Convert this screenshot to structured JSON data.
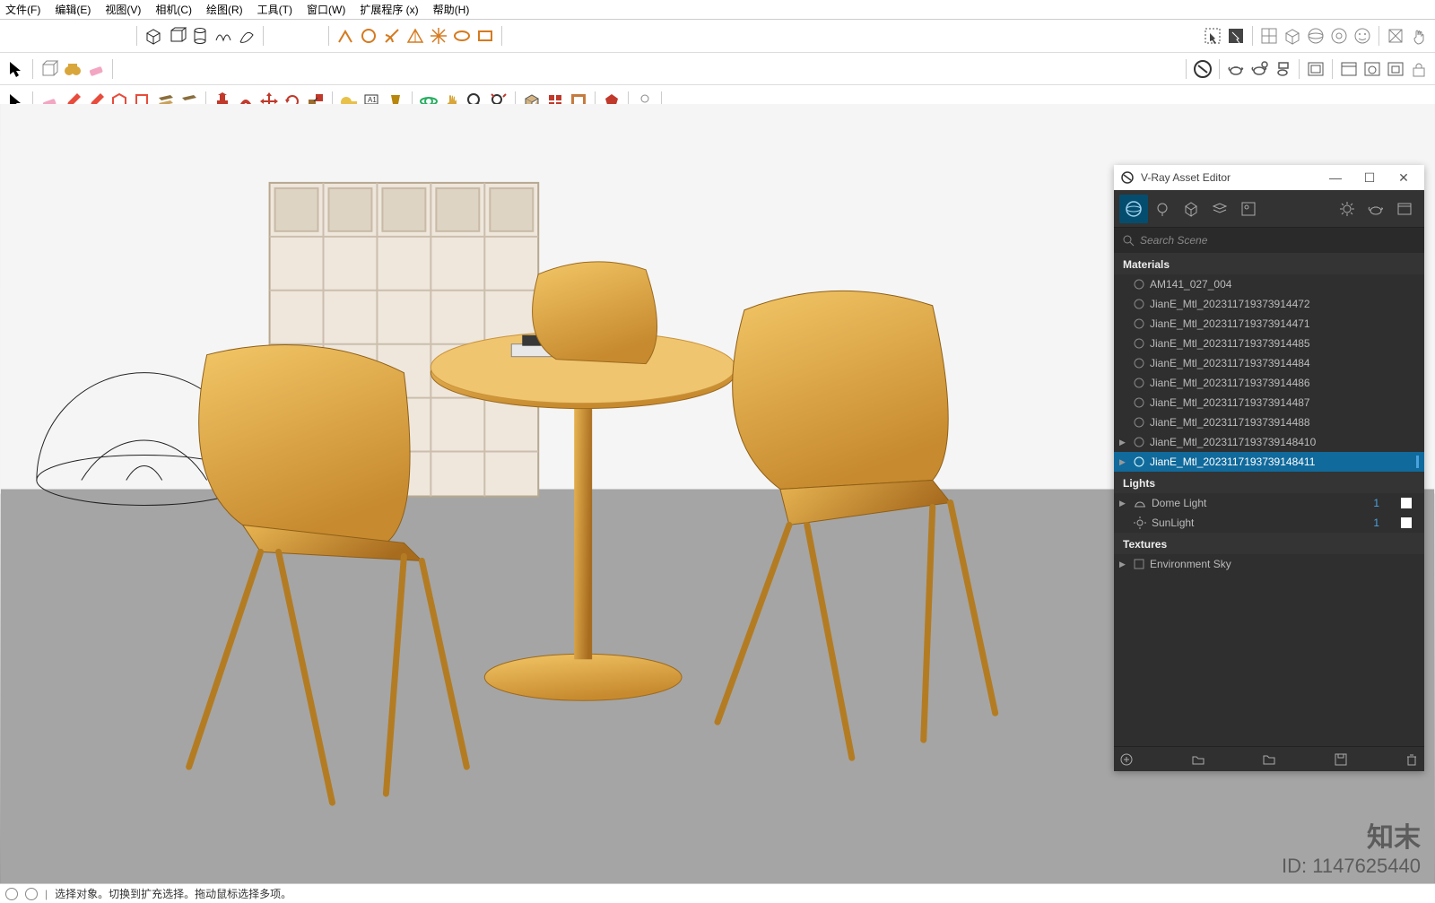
{
  "menu": {
    "items": [
      "文件(F)",
      "编辑(E)",
      "视图(V)",
      "相机(C)",
      "绘图(R)",
      "工具(T)",
      "窗口(W)",
      "扩展程序 (x)",
      "帮助(H)"
    ]
  },
  "vray": {
    "title": "V-Ray Asset Editor",
    "search_placeholder": "Search Scene",
    "sections": {
      "materials": "Materials",
      "lights": "Lights",
      "textures": "Textures"
    },
    "materials": [
      {
        "name": "AM141_027_004"
      },
      {
        "name": "JianE_Mtl_202311719373914472"
      },
      {
        "name": "JianE_Mtl_202311719373914471"
      },
      {
        "name": "JianE_Mtl_202311719373914485"
      },
      {
        "name": "JianE_Mtl_202311719373914484"
      },
      {
        "name": "JianE_Mtl_202311719373914486"
      },
      {
        "name": "JianE_Mtl_202311719373914487"
      },
      {
        "name": "JianE_Mtl_202311719373914488"
      },
      {
        "name": "JianE_Mtl_2023117193739148410",
        "expandable": true
      },
      {
        "name": "JianE_Mtl_2023117193739148411",
        "expandable": true,
        "selected": true
      }
    ],
    "lights": [
      {
        "name": "Dome Light",
        "count": "1",
        "icon": "dome"
      },
      {
        "name": "SunLight",
        "count": "1",
        "icon": "sun"
      }
    ],
    "textures": [
      {
        "name": "Environment Sky",
        "expandable": true
      }
    ]
  },
  "status": {
    "text": "选择对象。切换到扩充选择。拖动鼠标选择多项。"
  },
  "watermark": {
    "brand": "知末",
    "id_label": "ID:",
    "id_value": "1147625440"
  },
  "icons": {
    "cursor": "cursor",
    "circle": "○"
  }
}
